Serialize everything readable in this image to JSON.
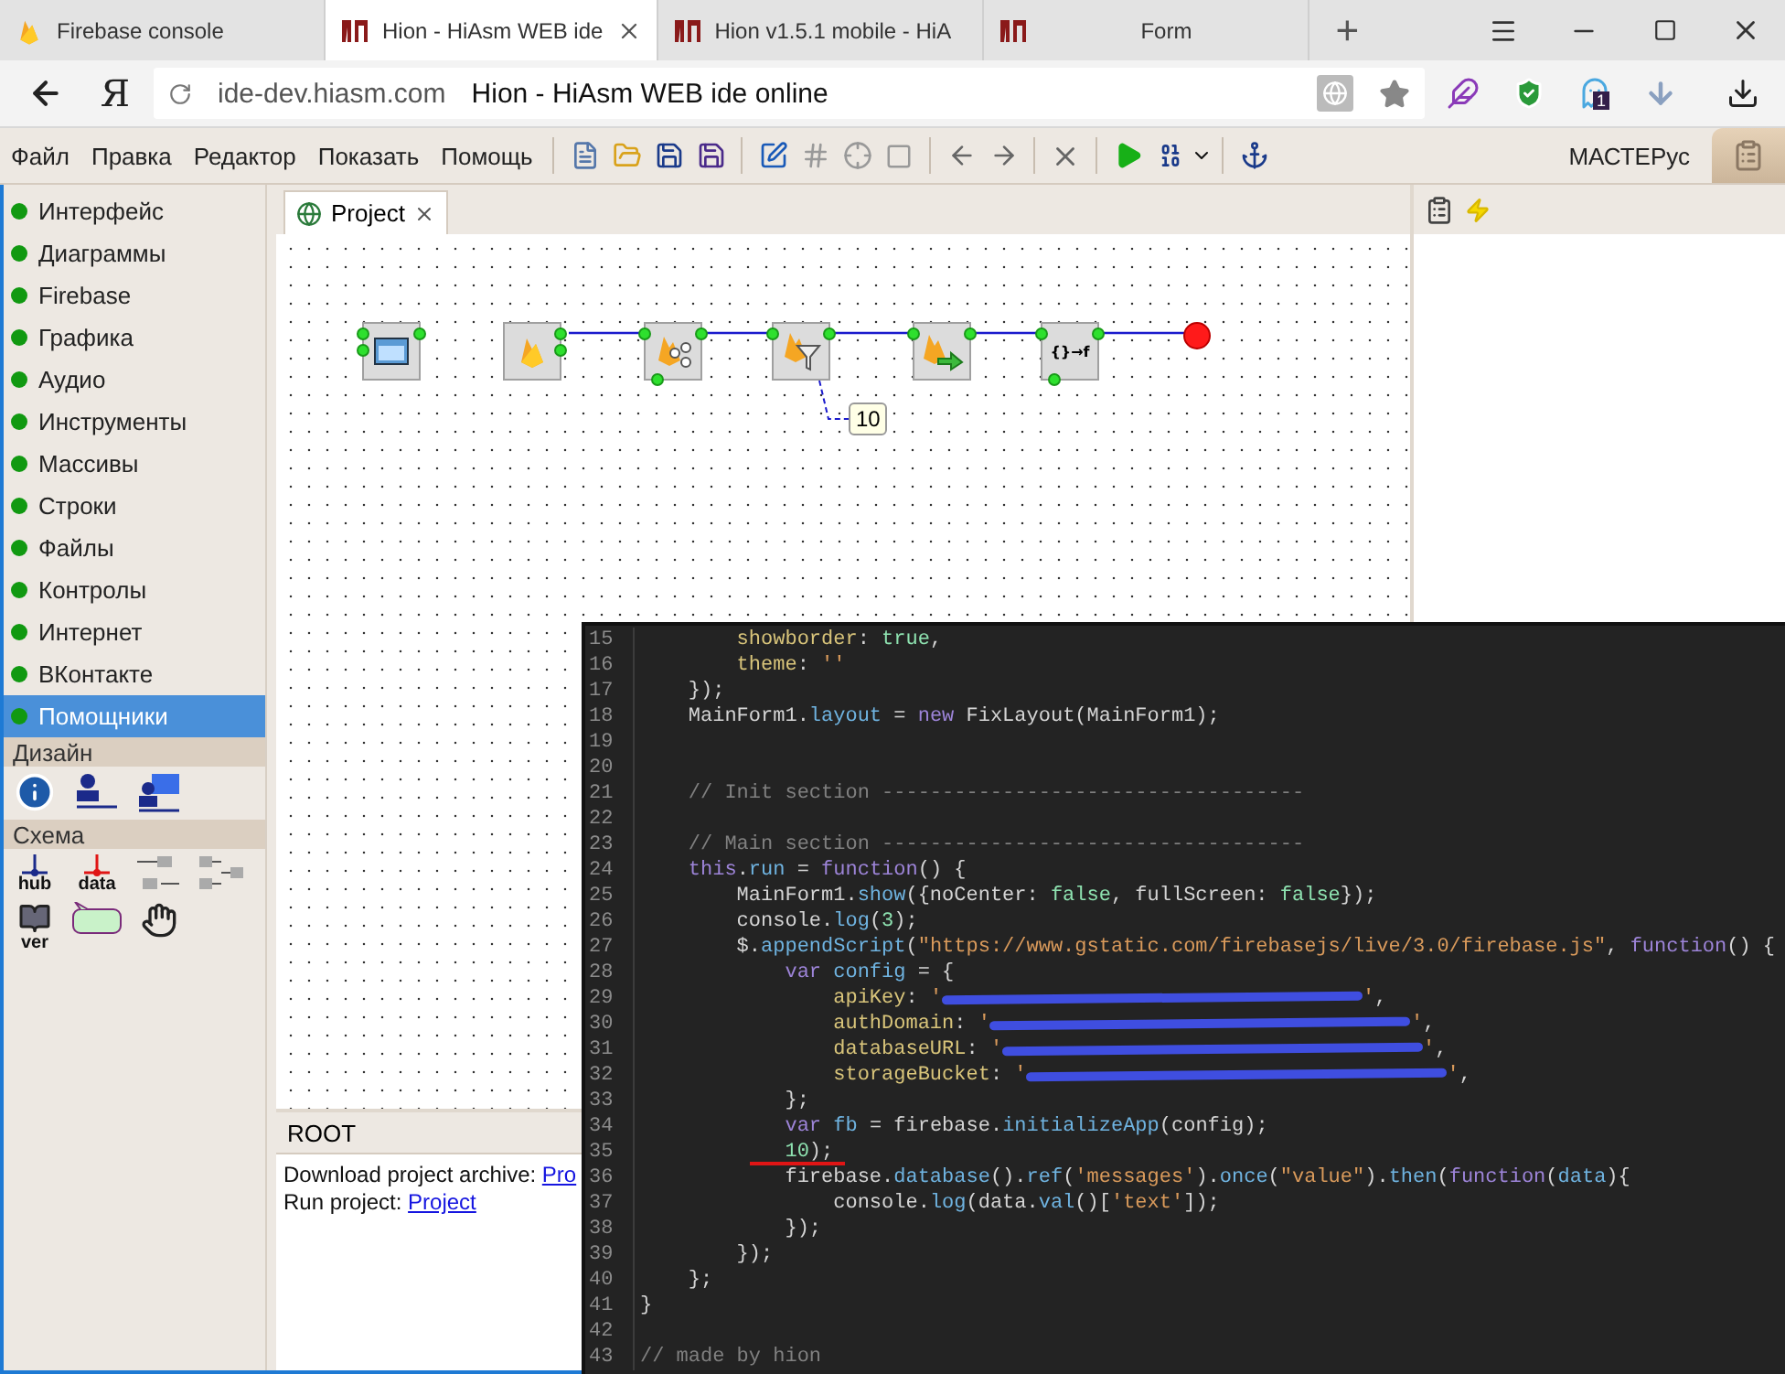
{
  "browser": {
    "tabs": [
      {
        "title": "Firebase console",
        "kind": "firebase",
        "selected": false
      },
      {
        "title": "Hion - HiAsm WEB ide",
        "kind": "hion",
        "selected": true
      },
      {
        "title": "Hion v1.5.1 mobile - HiA",
        "kind": "hion",
        "selected": false
      },
      {
        "title": "Form",
        "kind": "hion",
        "selected": false
      }
    ],
    "new_tab": "+",
    "logo": "Я",
    "url": "ide-dev.hiasm.com",
    "page_title": "Hion - HiAsm WEB ide online",
    "badge": "1"
  },
  "menu": [
    "Файл",
    "Правка",
    "Редактор",
    "Показать",
    "Помощь"
  ],
  "toolbar": {
    "user": "МАСТЕРус"
  },
  "sidebar": {
    "items": [
      {
        "label": "Интерфейс",
        "selected": false
      },
      {
        "label": "Диаграммы",
        "selected": false
      },
      {
        "label": "Firebase",
        "selected": false
      },
      {
        "label": "Графика",
        "selected": false
      },
      {
        "label": "Аудио",
        "selected": false
      },
      {
        "label": "Инструменты",
        "selected": false
      },
      {
        "label": "Массивы",
        "selected": false
      },
      {
        "label": "Строки",
        "selected": false
      },
      {
        "label": "Файлы",
        "selected": false
      },
      {
        "label": "Контролы",
        "selected": false
      },
      {
        "label": "Интернет",
        "selected": false
      },
      {
        "label": "ВКонтакте",
        "selected": false
      },
      {
        "label": "Помощники",
        "selected": true
      }
    ],
    "groups": [
      {
        "title": "Дизайн",
        "tools": [
          {
            "kind": "info"
          },
          {
            "kind": "link"
          },
          {
            "kind": "link-image"
          }
        ]
      },
      {
        "title": "Схема",
        "tools": [
          {
            "kind": "hub",
            "label": "hub"
          },
          {
            "kind": "data",
            "label": "data"
          },
          {
            "kind": "index-a"
          },
          {
            "kind": "index-b"
          },
          {
            "kind": "version",
            "label": "ver"
          },
          {
            "kind": "hint"
          },
          {
            "kind": "hand"
          }
        ]
      }
    ]
  },
  "editor_tab": {
    "title": "Project",
    "selected": true
  },
  "canvas": {
    "nodes": [
      {
        "kind": "form"
      },
      {
        "kind": "firebase"
      },
      {
        "kind": "fb-ref"
      },
      {
        "kind": "fb-filter"
      },
      {
        "kind": "fb-send"
      },
      {
        "kind": "json-func",
        "label": "{}→f"
      }
    ],
    "hint": "10"
  },
  "root_panel": {
    "title": "ROOT",
    "lines": [
      {
        "text": "Download project archive: ",
        "link": "Pro"
      },
      {
        "text": "Run project: ",
        "link": "Project"
      }
    ]
  },
  "code": {
    "lines": [
      {
        "number": "15",
        "tokens": [
          {
            "kind": "prop",
            "text": "        showborder"
          },
          {
            "kind": "plain",
            "text": ": "
          },
          {
            "kind": "literal",
            "text": "true"
          },
          {
            "kind": "plain",
            "text": ","
          }
        ]
      },
      {
        "number": "16",
        "tokens": [
          {
            "kind": "prop",
            "text": "        theme"
          },
          {
            "kind": "plain",
            "text": ": "
          },
          {
            "kind": "string",
            "text": "''"
          }
        ]
      },
      {
        "number": "17",
        "tokens": [
          {
            "kind": "plain",
            "text": "    });"
          }
        ]
      },
      {
        "number": "18",
        "tokens": [
          {
            "kind": "plain",
            "text": "    MainForm1."
          },
          {
            "kind": "member",
            "text": "layout"
          },
          {
            "kind": "plain",
            "text": " = "
          },
          {
            "kind": "keyword",
            "text": "new"
          },
          {
            "kind": "plain",
            "text": " FixLayout(MainForm1);"
          }
        ]
      },
      {
        "number": "19"
      },
      {
        "number": "20"
      },
      {
        "number": "21",
        "tokens": [
          {
            "kind": "comment",
            "text": "    // Init section -----------------------------------"
          }
        ]
      },
      {
        "number": "22"
      },
      {
        "number": "23",
        "tokens": [
          {
            "kind": "comment",
            "text": "    // Main section -----------------------------------"
          }
        ]
      },
      {
        "number": "24",
        "tokens": [
          {
            "kind": "keyword",
            "text": "    this"
          },
          {
            "kind": "plain",
            "text": "."
          },
          {
            "kind": "member",
            "text": "run"
          },
          {
            "kind": "plain",
            "text": " = "
          },
          {
            "kind": "keyword",
            "text": "function"
          },
          {
            "kind": "plain",
            "text": "() {"
          }
        ]
      },
      {
        "number": "25",
        "tokens": [
          {
            "kind": "plain",
            "text": "        MainForm1."
          },
          {
            "kind": "member",
            "text": "show"
          },
          {
            "kind": "plain",
            "text": "({noCenter: "
          },
          {
            "kind": "literal",
            "text": "false"
          },
          {
            "kind": "plain",
            "text": ", fullScreen: "
          },
          {
            "kind": "literal",
            "text": "false"
          },
          {
            "kind": "plain",
            "text": "});"
          }
        ]
      },
      {
        "number": "26",
        "tokens": [
          {
            "kind": "plain",
            "text": "        console."
          },
          {
            "kind": "member",
            "text": "log"
          },
          {
            "kind": "plain",
            "text": "("
          },
          {
            "kind": "literal",
            "text": "3"
          },
          {
            "kind": "plain",
            "text": ");"
          }
        ]
      },
      {
        "number": "27",
        "tokens": [
          {
            "kind": "plain",
            "text": "        $."
          },
          {
            "kind": "member",
            "text": "appendScript"
          },
          {
            "kind": "plain",
            "text": "("
          },
          {
            "kind": "string",
            "text": "\"https://www.gstatic.com/firebasejs/live/3.0/firebase.js\""
          },
          {
            "kind": "plain",
            "text": ", "
          },
          {
            "kind": "keyword",
            "text": "function"
          },
          {
            "kind": "plain",
            "text": "() {"
          }
        ]
      },
      {
        "number": "28",
        "tokens": [
          {
            "kind": "keyword",
            "text": "            var"
          },
          {
            "kind": "member",
            "text": " config"
          },
          {
            "kind": "plain",
            "text": " = {"
          }
        ]
      },
      {
        "number": "29",
        "tokens": [
          {
            "kind": "prop",
            "text": "                apiKey"
          },
          {
            "kind": "plain",
            "text": ": "
          },
          {
            "kind": "string",
            "text": "'"
          },
          {
            "kind": "redacted"
          },
          {
            "kind": "string",
            "text": "'"
          },
          {
            "kind": "plain",
            "text": ","
          }
        ]
      },
      {
        "number": "30",
        "tokens": [
          {
            "kind": "prop",
            "text": "                authDomain"
          },
          {
            "kind": "plain",
            "text": ": "
          },
          {
            "kind": "string",
            "text": "'"
          },
          {
            "kind": "redacted"
          },
          {
            "kind": "string",
            "text": "'"
          },
          {
            "kind": "plain",
            "text": ","
          }
        ]
      },
      {
        "number": "31",
        "tokens": [
          {
            "kind": "prop",
            "text": "                databaseURL"
          },
          {
            "kind": "plain",
            "text": ": "
          },
          {
            "kind": "string",
            "text": "'"
          },
          {
            "kind": "redacted"
          },
          {
            "kind": "string",
            "text": "'"
          },
          {
            "kind": "plain",
            "text": ","
          }
        ]
      },
      {
        "number": "32",
        "tokens": [
          {
            "kind": "prop",
            "text": "                storageBucket"
          },
          {
            "kind": "plain",
            "text": ": "
          },
          {
            "kind": "string",
            "text": "'"
          },
          {
            "kind": "redacted"
          },
          {
            "kind": "string",
            "text": "'"
          },
          {
            "kind": "plain",
            "text": ","
          }
        ]
      },
      {
        "number": "33",
        "tokens": [
          {
            "kind": "plain",
            "text": "            };"
          }
        ]
      },
      {
        "number": "34",
        "tokens": [
          {
            "kind": "keyword",
            "text": "            var"
          },
          {
            "kind": "member",
            "text": " fb"
          },
          {
            "kind": "plain",
            "text": " = firebase."
          },
          {
            "kind": "member",
            "text": "initializeApp"
          },
          {
            "kind": "plain",
            "text": "(config);"
          }
        ]
      },
      {
        "number": "35",
        "marked": true,
        "tokens": [
          {
            "kind": "literal",
            "text": "            10"
          },
          {
            "kind": "plain",
            "text": ");"
          }
        ]
      },
      {
        "number": "36",
        "tokens": [
          {
            "kind": "plain",
            "text": "            firebase."
          },
          {
            "kind": "member",
            "text": "database"
          },
          {
            "kind": "plain",
            "text": "()."
          },
          {
            "kind": "member",
            "text": "ref"
          },
          {
            "kind": "plain",
            "text": "("
          },
          {
            "kind": "string",
            "text": "'messages'"
          },
          {
            "kind": "plain",
            "text": ")."
          },
          {
            "kind": "member",
            "text": "once"
          },
          {
            "kind": "plain",
            "text": "("
          },
          {
            "kind": "string",
            "text": "\"value\""
          },
          {
            "kind": "plain",
            "text": ")."
          },
          {
            "kind": "member",
            "text": "then"
          },
          {
            "kind": "plain",
            "text": "("
          },
          {
            "kind": "keyword",
            "text": "function"
          },
          {
            "kind": "plain",
            "text": "("
          },
          {
            "kind": "member",
            "text": "data"
          },
          {
            "kind": "plain",
            "text": "){"
          }
        ]
      },
      {
        "number": "37",
        "tokens": [
          {
            "kind": "plain",
            "text": "                console."
          },
          {
            "kind": "member",
            "text": "log"
          },
          {
            "kind": "plain",
            "text": "(data."
          },
          {
            "kind": "member",
            "text": "val"
          },
          {
            "kind": "plain",
            "text": "()["
          },
          {
            "kind": "string",
            "text": "'text'"
          },
          {
            "kind": "plain",
            "text": "]);"
          }
        ]
      },
      {
        "number": "38",
        "tokens": [
          {
            "kind": "plain",
            "text": "            });"
          }
        ]
      },
      {
        "number": "39",
        "tokens": [
          {
            "kind": "plain",
            "text": "        });"
          }
        ]
      },
      {
        "number": "40",
        "tokens": [
          {
            "kind": "plain",
            "text": "    };"
          }
        ]
      },
      {
        "number": "41",
        "tokens": [
          {
            "kind": "plain",
            "text": "}"
          }
        ]
      },
      {
        "number": "42"
      },
      {
        "number": "43",
        "tokens": [
          {
            "kind": "comment",
            "text": "// made by hion"
          }
        ]
      }
    ]
  }
}
